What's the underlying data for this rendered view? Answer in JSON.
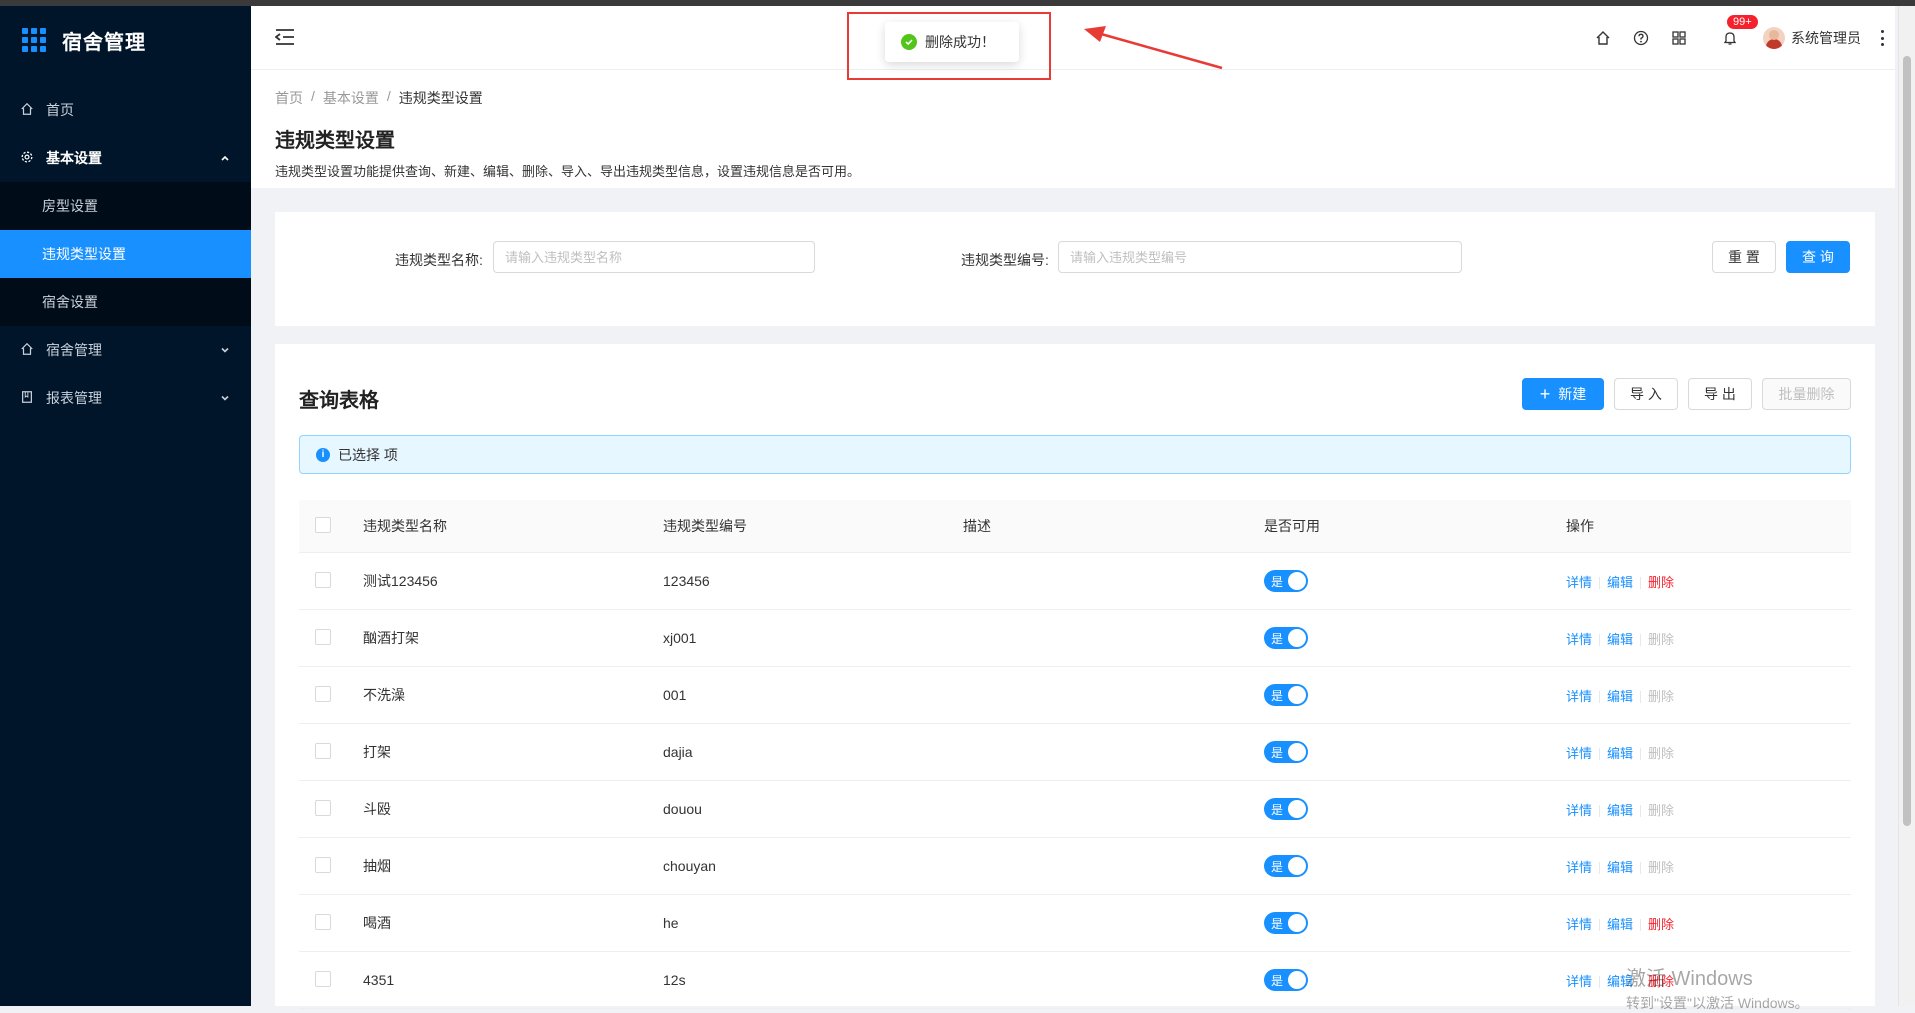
{
  "app": {
    "title": "宿舍管理"
  },
  "sidebar": {
    "items": [
      {
        "label": "首页",
        "icon": "home-icon"
      },
      {
        "label": "基本设置",
        "icon": "gear-icon",
        "open": true,
        "children": [
          {
            "label": "房型设置",
            "active": false
          },
          {
            "label": "违规类型设置",
            "active": true
          },
          {
            "label": "宿舍设置",
            "active": false
          }
        ]
      },
      {
        "label": "宿舍管理",
        "icon": "home-icon"
      },
      {
        "label": "报表管理",
        "icon": "book-icon"
      }
    ]
  },
  "header": {
    "badge": "99+",
    "user_name": "系统管理员"
  },
  "toast": {
    "message": "删除成功！",
    "status_color": "#52c41a"
  },
  "breadcrumb": [
    "首页",
    "基本设置",
    "违规类型设置"
  ],
  "page": {
    "title": "违规类型设置",
    "description": "违规类型设置功能提供查询、新建、编辑、删除、导入、导出违规类型信息，设置违规信息是否可用。"
  },
  "search": {
    "name_label": "违规类型名称:",
    "name_placeholder": "请输入违规类型名称",
    "name_value": "",
    "code_label": "违规类型编号:",
    "code_placeholder": "请输入违规类型编号",
    "code_value": "",
    "reset_label": "重 置",
    "query_label": "查 询"
  },
  "table_card": {
    "title": "查询表格",
    "new_label": "新建",
    "import_label": "导 入",
    "export_label": "导 出",
    "batch_delete_label": "批量删除",
    "selected_text": "已选择 项",
    "columns": [
      "违规类型名称",
      "违规类型编号",
      "描述",
      "是否可用",
      "操作"
    ],
    "switch_label": "是",
    "ops": {
      "detail": "详情",
      "edit": "编辑",
      "delete": "删除"
    },
    "rows": [
      {
        "name": "测试123456",
        "code": "123456",
        "desc": "",
        "enabled": true,
        "delete_enabled": true
      },
      {
        "name": "酗酒打架",
        "code": "xj001",
        "desc": "",
        "enabled": true,
        "delete_enabled": false
      },
      {
        "name": "不洗澡",
        "code": "001",
        "desc": "",
        "enabled": true,
        "delete_enabled": false
      },
      {
        "name": "打架",
        "code": "dajia",
        "desc": "",
        "enabled": true,
        "delete_enabled": false
      },
      {
        "name": "斗殴",
        "code": "douou",
        "desc": "",
        "enabled": true,
        "delete_enabled": false
      },
      {
        "name": "抽烟",
        "code": "chouyan",
        "desc": "",
        "enabled": true,
        "delete_enabled": false
      },
      {
        "name": "喝酒",
        "code": "he",
        "desc": "",
        "enabled": true,
        "delete_enabled": true
      },
      {
        "name": "4351",
        "code": "12s",
        "desc": "",
        "enabled": true,
        "delete_enabled": true
      }
    ]
  },
  "watermark": {
    "line1": "激活 Windows",
    "line2": "转到\"设置\"以激活 Windows。"
  },
  "colors": {
    "primary": "#1890ff",
    "sidebar_bg": "#001529",
    "danger": "#f5222d",
    "annotation": "#e83b35"
  }
}
